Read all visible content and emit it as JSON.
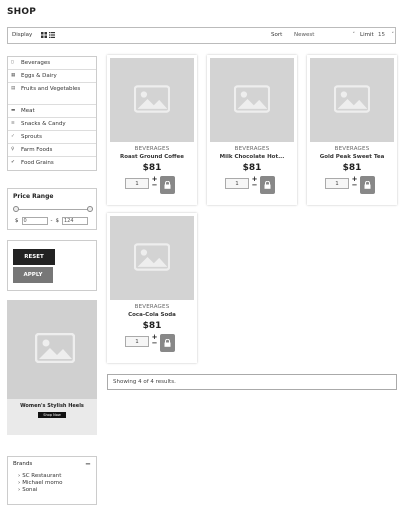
{
  "page_title": "SHOP",
  "toolbar": {
    "display_label": "Display",
    "sort_label": "Sort",
    "sort_value": "Newest",
    "limit_label": "Limit",
    "limit_value": "15"
  },
  "categories": [
    {
      "label": "Beverages",
      "icon": "bottle-icon"
    },
    {
      "label": "Eggs & Dairy",
      "icon": "dairy-icon"
    },
    {
      "label": "Fruits and Vegetables",
      "icon": "fruit-icon"
    },
    {
      "label": "Meat",
      "icon": "meat-icon"
    },
    {
      "label": "Snacks & Candy",
      "icon": "snack-icon"
    },
    {
      "label": "Sprouts",
      "icon": "sprout-icon"
    },
    {
      "label": "Farm Foods",
      "icon": "farm-icon"
    },
    {
      "label": "Food Grains",
      "icon": "grain-icon"
    }
  ],
  "price_filter": {
    "title": "Price Range",
    "currency": "$",
    "separator": "-",
    "min": "0",
    "max": "124"
  },
  "buttons": {
    "reset": "RESET",
    "apply": "APPLY"
  },
  "ad": {
    "text": "Women's Stylish Heels",
    "button": "Shop Now"
  },
  "brands": {
    "title": "Brands",
    "toggle": "−",
    "items": [
      "SC Restaurant",
      "Michael momo",
      "Sonai"
    ]
  },
  "products": [
    {
      "category": "BEVERAGES",
      "name": "Roast Ground Coffee",
      "price": "$81",
      "qty": "1"
    },
    {
      "category": "BEVERAGES",
      "name": "Milk Chocolate Hot...",
      "price": "$81",
      "qty": "1"
    },
    {
      "category": "BEVERAGES",
      "name": "Gold Peak Sweet Tea",
      "price": "$81",
      "qty": "1"
    },
    {
      "category": "BEVERAGES",
      "name": "Coca-Cola Soda",
      "price": "$81",
      "qty": "1"
    }
  ],
  "results_text": "Showing 4 of 4 results.",
  "colors": {
    "placeholder_bg": "#d3d3d3",
    "reset_bg": "#222222",
    "apply_bg": "#777777",
    "cart_bg": "#888888"
  }
}
